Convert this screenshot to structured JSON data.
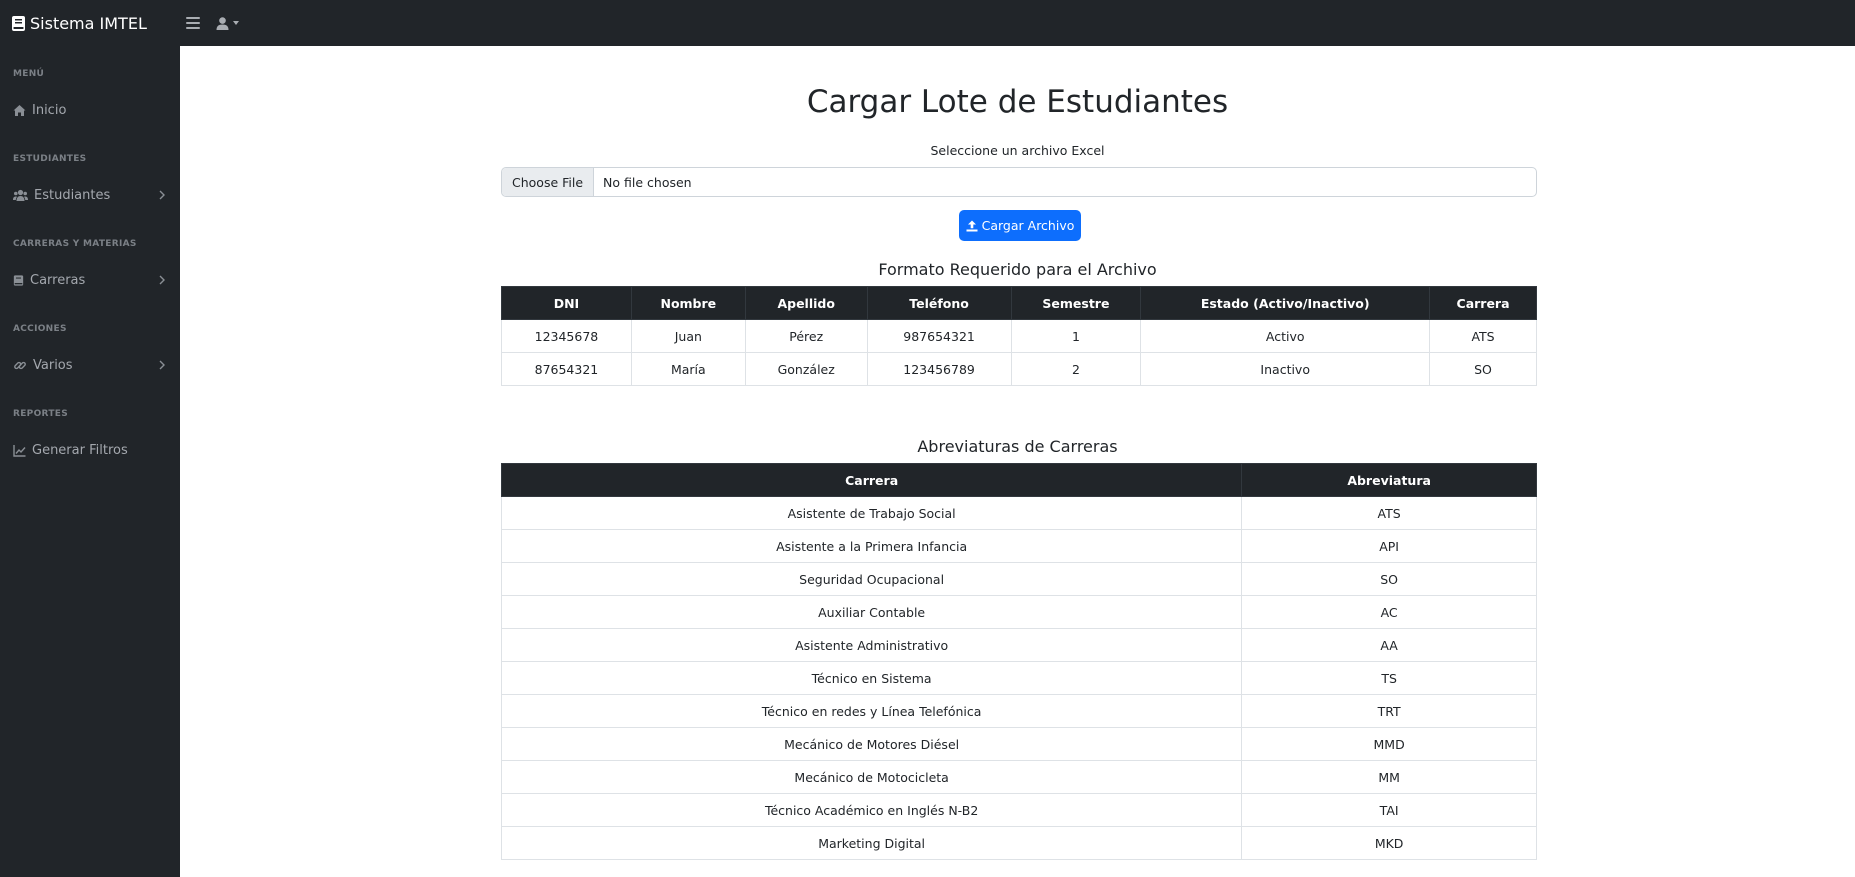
{
  "app": {
    "brand": "Sistema IMTEL"
  },
  "sidebar": {
    "sections": [
      {
        "heading": "MENÚ",
        "items": [
          {
            "label": "Inicio",
            "icon": "home-icon",
            "has_chevron": false
          }
        ]
      },
      {
        "heading": "ESTUDIANTES",
        "items": [
          {
            "label": "Estudiantes",
            "icon": "users-icon",
            "has_chevron": true
          }
        ]
      },
      {
        "heading": "CARRERAS Y MATERIAS",
        "items": [
          {
            "label": "Carreras",
            "icon": "book-icon",
            "has_chevron": true
          }
        ]
      },
      {
        "heading": "ACCIONES",
        "items": [
          {
            "label": "Varios",
            "icon": "link-icon",
            "has_chevron": true
          }
        ]
      },
      {
        "heading": "REPORTES",
        "items": [
          {
            "label": "Generar Filtros",
            "icon": "chart-icon",
            "has_chevron": false
          }
        ]
      }
    ]
  },
  "main": {
    "title": "Cargar Lote de Estudiantes",
    "file_label": "Seleccione un archivo Excel",
    "file_button": "Choose File",
    "file_status": "No file chosen",
    "upload_button": "Cargar Archivo",
    "format_title": "Formato Requerido para el Archivo",
    "format_table": {
      "headers": [
        "DNI",
        "Nombre",
        "Apellido",
        "Teléfono",
        "Semestre",
        "Estado (Activo/Inactivo)",
        "Carrera"
      ],
      "rows": [
        [
          "12345678",
          "Juan",
          "Pérez",
          "987654321",
          "1",
          "Activo",
          "ATS"
        ],
        [
          "87654321",
          "María",
          "González",
          "123456789",
          "2",
          "Inactivo",
          "SO"
        ]
      ]
    },
    "abbr_title": "Abreviaturas de Carreras",
    "abbr_table": {
      "headers": [
        "Carrera",
        "Abreviatura"
      ],
      "rows": [
        [
          "Asistente de Trabajo Social",
          "ATS"
        ],
        [
          "Asistente a la Primera Infancia",
          "API"
        ],
        [
          "Seguridad Ocupacional",
          "SO"
        ],
        [
          "Auxiliar Contable",
          "AC"
        ],
        [
          "Asistente Administrativo",
          "AA"
        ],
        [
          "Técnico en Sistema",
          "TS"
        ],
        [
          "Técnico en redes y Línea Telefónica",
          "TRT"
        ],
        [
          "Mecánico de Motores Diésel",
          "MMD"
        ],
        [
          "Mecánico de Motocicleta",
          "MM"
        ],
        [
          "Técnico Académico en Inglés N-B2",
          "TAI"
        ],
        [
          "Marketing Digital",
          "MKD"
        ]
      ]
    }
  },
  "colors": {
    "navbar": "#212529",
    "sidebar": "#212529",
    "primary": "#0d6efd",
    "table_header": "#212529"
  }
}
